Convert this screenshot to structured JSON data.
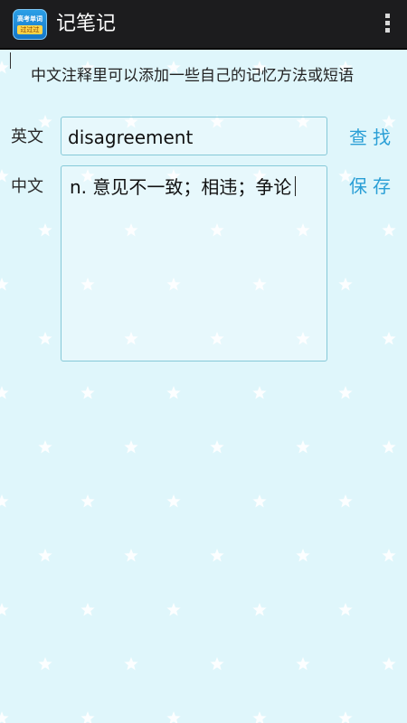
{
  "app": {
    "title": "记笔记",
    "icon_line1": "高考单词",
    "icon_line2": "过过过"
  },
  "tip": "中文注释里可以添加一些自己的记忆方法或短语",
  "english": {
    "label": "英文",
    "value": "disagreement",
    "action": "查找"
  },
  "chinese": {
    "label": "中文",
    "value": "n. 意见不一致；相违；争论",
    "action": "保存"
  },
  "colors": {
    "action_bar": "#1c1c1e",
    "background": "#dff6fb",
    "accent": "#2a9fd6"
  }
}
